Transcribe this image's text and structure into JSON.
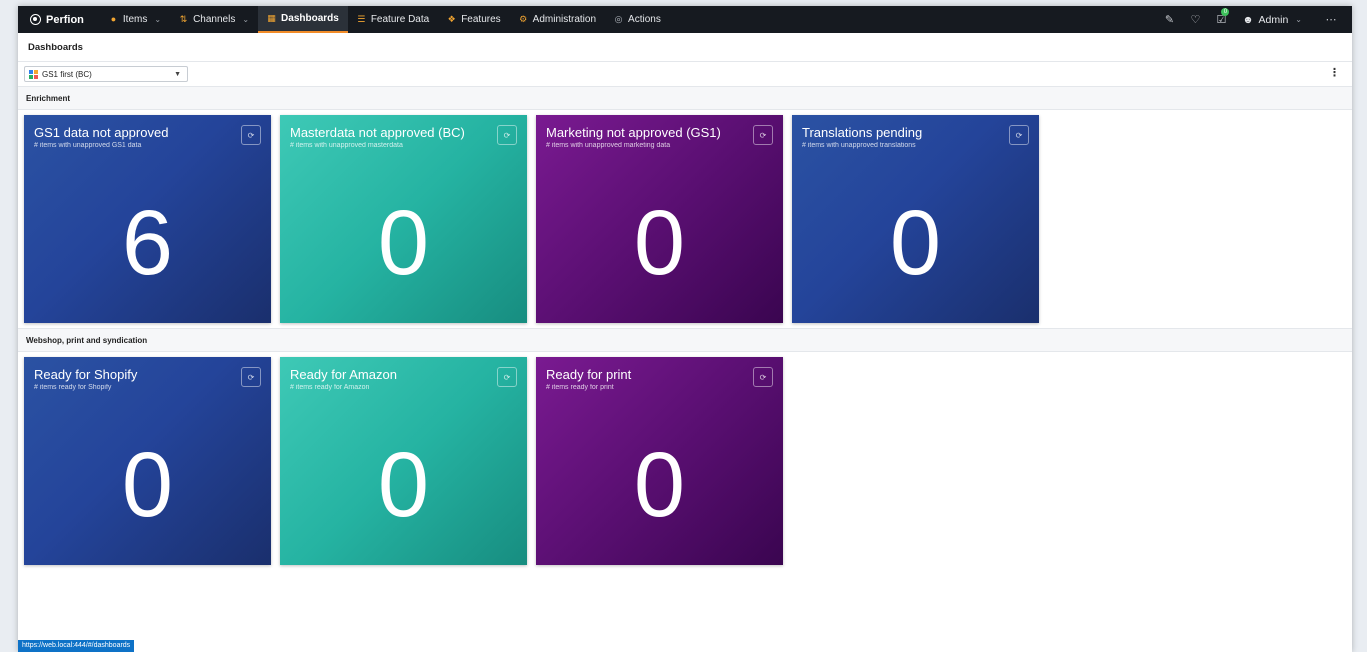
{
  "app": {
    "brand": "Perfion",
    "nav": [
      {
        "label": "Items",
        "icon": "items-icon",
        "dropdown": true,
        "active": false
      },
      {
        "label": "Channels",
        "icon": "channels-icon",
        "dropdown": true,
        "active": false
      },
      {
        "label": "Dashboards",
        "icon": "dashboards-icon",
        "dropdown": false,
        "active": true
      },
      {
        "label": "Feature Data",
        "icon": "feature-data-icon",
        "dropdown": false,
        "active": false
      },
      {
        "label": "Features",
        "icon": "features-icon",
        "dropdown": false,
        "active": false
      },
      {
        "label": "Administration",
        "icon": "administration-icon",
        "dropdown": false,
        "active": false
      },
      {
        "label": "Actions",
        "icon": "actions-icon",
        "dropdown": false,
        "active": false
      }
    ],
    "right": {
      "tasks_badge": "0",
      "user": "Admin"
    },
    "accent": "#f28c28"
  },
  "page": {
    "title": "Dashboards",
    "dashboard_select": "GS1 first (BC)"
  },
  "sections": [
    {
      "title": "Enrichment",
      "cards": [
        {
          "title": "GS1 data not approved",
          "subtitle": "# items with unapproved GS1 data",
          "value": "6",
          "color": "blue"
        },
        {
          "title": "Masterdata not approved (BC)",
          "subtitle": "# items with unapproved masterdata",
          "value": "0",
          "color": "teal"
        },
        {
          "title": "Marketing not approved (GS1)",
          "subtitle": "# items with unapproved marketing data",
          "value": "0",
          "color": "purple"
        },
        {
          "title": "Translations pending",
          "subtitle": "# items with unapproved translations",
          "value": "0",
          "color": "blue"
        }
      ]
    },
    {
      "title": "Webshop, print and syndication",
      "cards": [
        {
          "title": "Ready for Shopify",
          "subtitle": "# items ready for Shopify",
          "value": "0",
          "color": "blue"
        },
        {
          "title": "Ready for Amazon",
          "subtitle": "# items ready for Amazon",
          "value": "0",
          "color": "teal"
        },
        {
          "title": "Ready for print",
          "subtitle": "# items ready for print",
          "value": "0",
          "color": "purple"
        }
      ]
    }
  ],
  "status_url": "https://web.local:444/#/dashboards",
  "colors": {
    "blue": "#24449a",
    "teal": "#25b3a2",
    "purple": "#5a0f72"
  }
}
